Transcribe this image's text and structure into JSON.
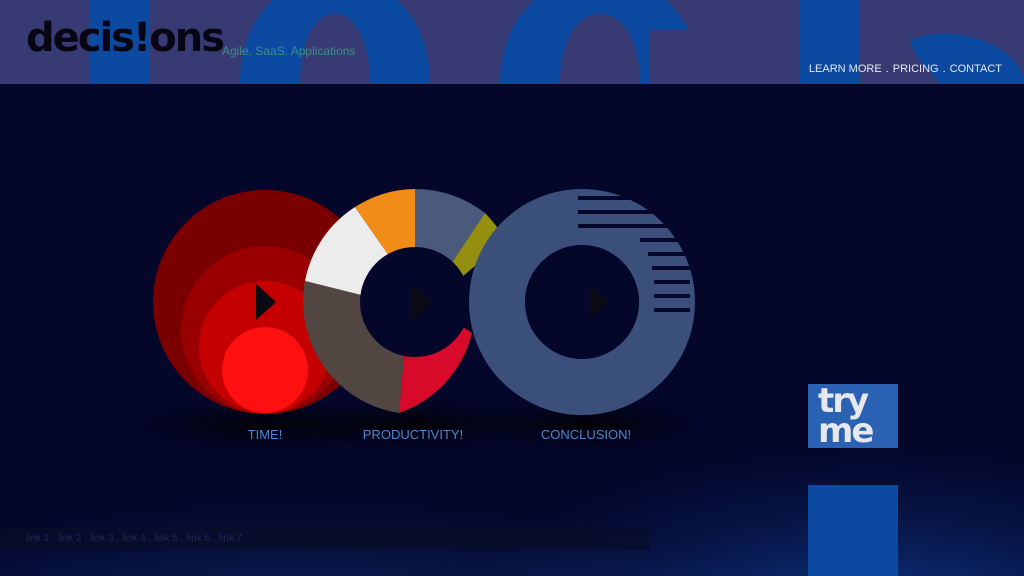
{
  "brand": {
    "logo_text": "decis!ons",
    "tagline": "Agile. SaaS. Applications"
  },
  "top_nav": {
    "items": [
      "LEARN MORE",
      "PRICING",
      "CONTACT"
    ],
    "separator": "."
  },
  "circles": [
    {
      "label": "TIME!",
      "play_icon": "play-icon"
    },
    {
      "label": "PRODUCTIVITY!",
      "play_icon": "play-icon"
    },
    {
      "label": "CONCLUSION!",
      "play_icon": "play-icon"
    }
  ],
  "try_me": {
    "line1": "try",
    "line2": "me"
  },
  "footer_links": [
    "link 1",
    "link 2",
    "link 3",
    "link 4",
    "link 5",
    "link 6",
    "link 7"
  ],
  "colors": {
    "background": "#04062a",
    "header": "#383a73",
    "accent_blue": "#2a61b3",
    "label_blue": "#4b86d2",
    "tagline": "#3b8f86"
  }
}
